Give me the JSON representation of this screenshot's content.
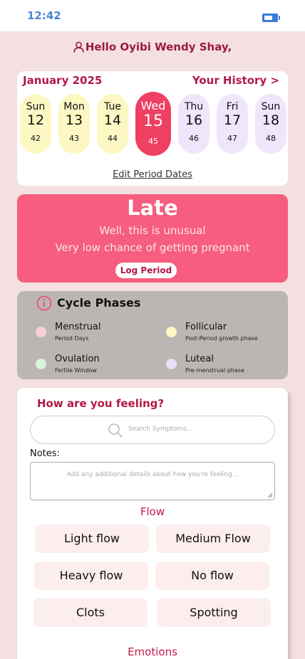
{
  "status_bar": {
    "time": "12:42",
    "battery_icon": "battery-icon"
  },
  "greeting": {
    "icon": "user-icon",
    "text": "Hello Oyibi Wendy Shay,"
  },
  "calendar": {
    "month": "January 2025",
    "history_link": "Your History >",
    "days": [
      {
        "name": "Sun",
        "date": "12",
        "cycle_day": "42",
        "color": "#fdf7c4",
        "selected": false
      },
      {
        "name": "Mon",
        "date": "13",
        "cycle_day": "43",
        "color": "#fdf7c4",
        "selected": false
      },
      {
        "name": "Tue",
        "date": "14",
        "cycle_day": "44",
        "color": "#fdf7c4",
        "selected": false
      },
      {
        "name": "Wed",
        "date": "15",
        "cycle_day": "45",
        "color": "#ef3f62",
        "selected": true
      },
      {
        "name": "Thu",
        "date": "16",
        "cycle_day": "46",
        "color": "#efe6fb",
        "selected": false
      },
      {
        "name": "Fri",
        "date": "17",
        "cycle_day": "47",
        "color": "#efe6fb",
        "selected": false
      },
      {
        "name": "Sun",
        "date": "18",
        "cycle_day": "48",
        "color": "#efe6fb",
        "selected": false
      }
    ],
    "edit_link": "Edit Period Dates"
  },
  "status_card": {
    "title": "Late",
    "line1": "Well, this is unusual",
    "line2": "Very low chance of getting pregnant",
    "button": "Log Period",
    "color": "#f65d7e"
  },
  "cycle_phases": {
    "title": "Cycle Phases",
    "icon": "info-icon",
    "phases": [
      {
        "name": "Menstrual",
        "desc": "Period Days",
        "color": "#f9cfd5"
      },
      {
        "name": "Follicular",
        "desc": "Post-Period growth phase",
        "color": "#fdf7c4"
      },
      {
        "name": "Ovulation",
        "desc": "Fertile Window",
        "color": "#d8f5dc"
      },
      {
        "name": "Luteal",
        "desc": "Pre-menstrual phase",
        "color": "#e8e0f8"
      }
    ]
  },
  "feelings": {
    "title": "How are you feeling?",
    "search_placeholder": "Search Symptoms...",
    "notes_label": "Notes:",
    "notes_placeholder": "Add any additional details about how you're feeling...",
    "flow_label": "Flow",
    "flow_options": [
      "Light flow",
      "Medium Flow",
      "Heavy flow",
      "No flow",
      "Clots",
      "Spotting"
    ],
    "emotions_label": "Emotions"
  }
}
